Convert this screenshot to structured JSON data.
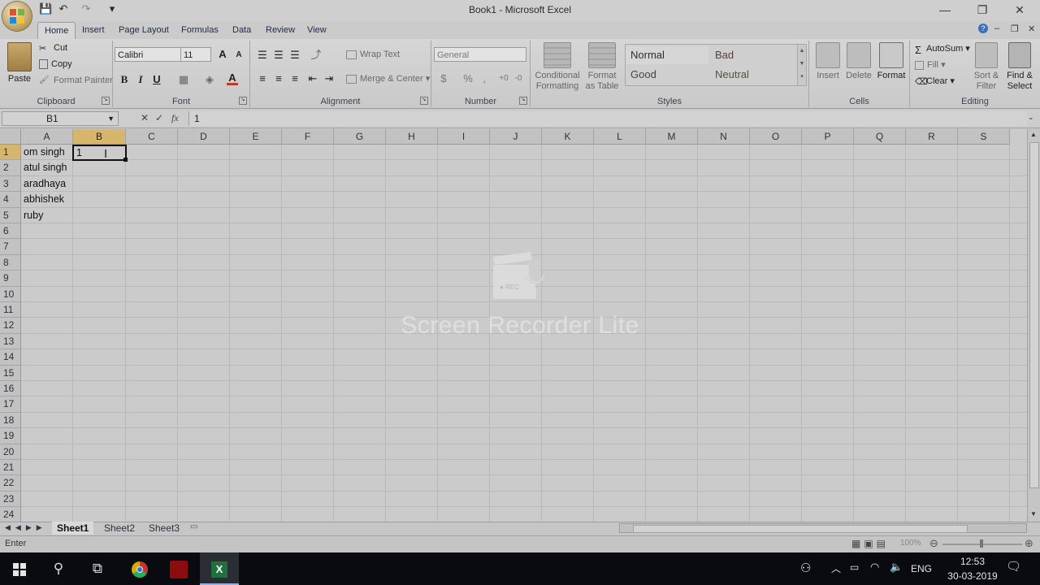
{
  "window": {
    "title": "Book1 - Microsoft Excel",
    "controls": {
      "minimize": "—",
      "restore": "❐",
      "close": "✕"
    }
  },
  "quick_access": {
    "save": "💾",
    "undo": "↶",
    "redo": "↷",
    "customize": "▾"
  },
  "ribbon": {
    "tabs": [
      "Home",
      "Insert",
      "Page Layout",
      "Formulas",
      "Data",
      "Review",
      "View"
    ],
    "active_tab": "Home",
    "clipboard": {
      "label": "Clipboard",
      "paste": "Paste",
      "cut": "Cut",
      "copy": "Copy",
      "format_painter": "Format Painter"
    },
    "font": {
      "label": "Font",
      "name": "Calibri",
      "size": "11",
      "grow": "A",
      "shrink": "A",
      "bold": "B",
      "italic": "I",
      "underline": "U",
      "font_color": "#c0392b"
    },
    "alignment": {
      "label": "Alignment",
      "wrap_text": "Wrap Text",
      "merge_center": "Merge & Center"
    },
    "number": {
      "label": "Number",
      "format": "General",
      "percent": "%",
      "comma": ","
    },
    "styles": {
      "label": "Styles",
      "conditional": "Conditional Formatting",
      "format_table": "Format as Table",
      "normal": "Normal",
      "bad": "Bad",
      "good": "Good",
      "neutral": "Neutral"
    },
    "cells": {
      "label": "Cells",
      "insert": "Insert",
      "delete": "Delete",
      "format": "Format"
    },
    "editing": {
      "label": "Editing",
      "autosum": "AutoSum",
      "fill": "Fill",
      "clear": "Clear",
      "sort_filter": "Sort & Filter",
      "find_select": "Find & Select"
    }
  },
  "formula_bar": {
    "name_box": "B1",
    "cancel": "✕",
    "enter": "✓",
    "fx": "fx",
    "content": "1"
  },
  "columns": [
    "A",
    "B",
    "C",
    "D",
    "E",
    "F",
    "G",
    "H",
    "I",
    "J",
    "K",
    "L",
    "M",
    "N",
    "O",
    "P",
    "Q",
    "R",
    "S"
  ],
  "rows": [
    "1",
    "2",
    "3",
    "4",
    "5",
    "6",
    "7",
    "8",
    "9",
    "10",
    "11",
    "12",
    "13",
    "14",
    "15",
    "16",
    "17",
    "18",
    "19",
    "20",
    "21",
    "22",
    "23",
    "24"
  ],
  "cells": {
    "A1": "om singh",
    "A2": "atul singh",
    "A3": "aradhaya",
    "A4": "abhishek",
    "A5": "ruby",
    "B1": "1"
  },
  "selected_cell": "B1",
  "sheets": [
    "Sheet1",
    "Sheet2",
    "Sheet3"
  ],
  "active_sheet": "Sheet1",
  "status": {
    "mode": "Enter",
    "zoom": "100%"
  },
  "watermark": {
    "text": "Screen Recorder Lite",
    "badge": "● REC"
  },
  "taskbar": {
    "language": "ENG",
    "time": "12:53",
    "date": "30-03-2019"
  }
}
